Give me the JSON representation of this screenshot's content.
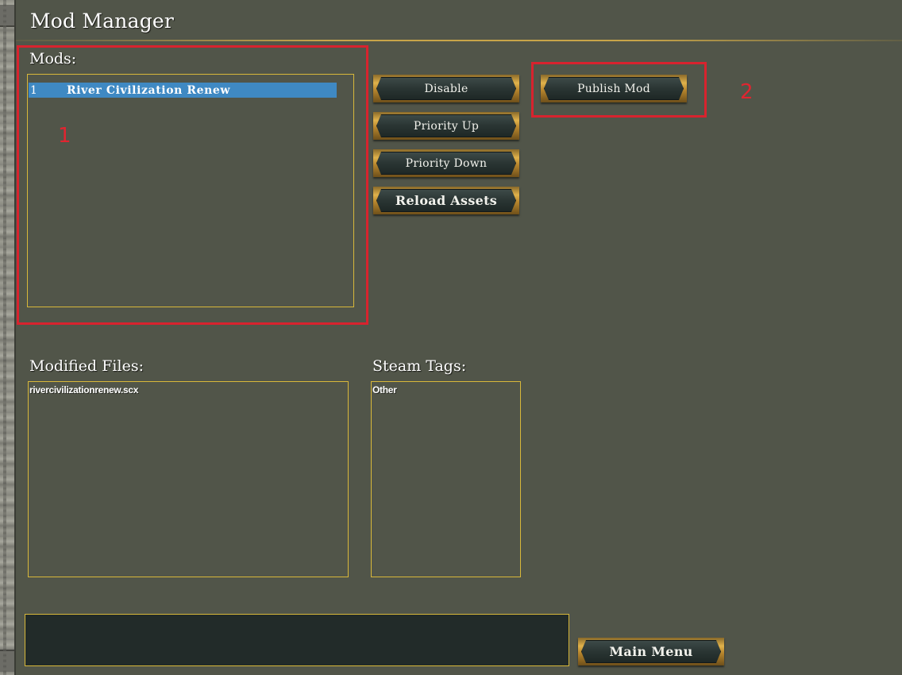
{
  "window": {
    "title": "Mod Manager"
  },
  "mods": {
    "label": "Mods:",
    "items": [
      {
        "number": "1",
        "name": "River Civilization Renew",
        "selected": true
      }
    ]
  },
  "buttons": {
    "disable": "Disable",
    "priority_up": "Priority Up",
    "priority_down": "Priority Down",
    "reload_assets": "Reload Assets",
    "publish_mod": "Publish Mod",
    "main_menu": "Main Menu"
  },
  "modified_files": {
    "label": "Modified Files:",
    "items": [
      "rivercivilizationrenew.scx"
    ]
  },
  "steam_tags": {
    "label": "Steam Tags:",
    "items": [
      "Other"
    ]
  },
  "annotations": {
    "mods_panel": "1",
    "publish_button": "2",
    "color": "#d8232e"
  },
  "colors": {
    "background": "#515549",
    "accent_gold": "#d8b83a",
    "selection": "#3f89c3"
  }
}
